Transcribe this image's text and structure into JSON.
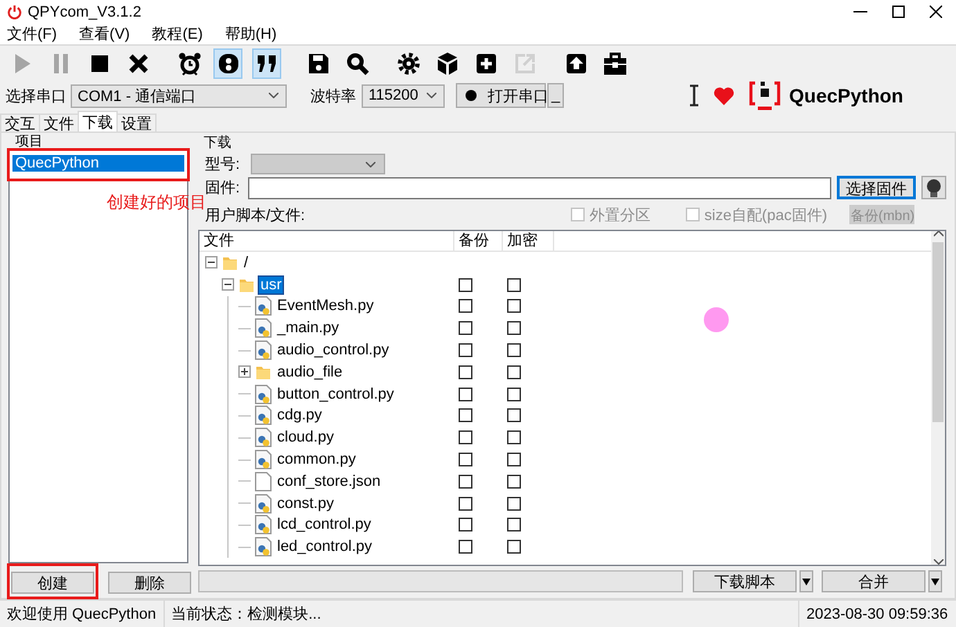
{
  "window": {
    "title": "QPYcom_V3.1.2"
  },
  "menu": [
    {
      "label": "文件(F)"
    },
    {
      "label": "查看(V)"
    },
    {
      "label": "教程(E)"
    },
    {
      "label": "帮助(H)"
    }
  ],
  "toolbar": [
    [
      {
        "kind": "play",
        "disabled": true,
        "pressed": false
      },
      {
        "kind": "pause",
        "disabled": true,
        "pressed": false
      },
      {
        "kind": "stop",
        "disabled": false,
        "pressed": false
      },
      {
        "kind": "cross",
        "disabled": false,
        "pressed": false
      }
    ],
    [
      {
        "kind": "alarm",
        "disabled": false,
        "pressed": false
      },
      {
        "kind": "badge",
        "disabled": false,
        "pressed": true
      },
      {
        "kind": "quote",
        "disabled": false,
        "pressed": true
      }
    ],
    [
      {
        "kind": "save",
        "disabled": false,
        "pressed": false
      },
      {
        "kind": "search",
        "disabled": false,
        "pressed": false
      }
    ],
    [
      {
        "kind": "gear",
        "disabled": false,
        "pressed": false
      },
      {
        "kind": "cube",
        "disabled": false,
        "pressed": false
      },
      {
        "kind": "add",
        "disabled": false,
        "pressed": false
      },
      {
        "kind": "export",
        "disabled": true,
        "pressed": false
      }
    ],
    [
      {
        "kind": "upload",
        "disabled": false,
        "pressed": false
      },
      {
        "kind": "toolbox",
        "disabled": false,
        "pressed": false
      }
    ]
  ],
  "port_bar": {
    "port_label": "选择串口",
    "port": "COM1 - 通信端口",
    "baud_label": "波特率",
    "baud": "115200",
    "open_button": "打开串口",
    "more_button": "_",
    "brand": "QuecPython"
  },
  "tabs": [
    {
      "label": "交互",
      "selected": false
    },
    {
      "label": "文件",
      "selected": false
    },
    {
      "label": "下载",
      "selected": true
    },
    {
      "label": "设置",
      "selected": false
    }
  ],
  "projects": {
    "title": "项目",
    "items": [
      {
        "name": "QuecPython",
        "selected": true,
        "highlighted": true
      }
    ],
    "buttons": [
      {
        "label": "创建",
        "highlighted": true
      },
      {
        "label": "删除",
        "highlighted": false
      }
    ]
  },
  "annotation": {
    "text": "创建好的项目"
  },
  "download": {
    "title": "下载",
    "model_label": "型号:",
    "model": {
      "disabled": true
    },
    "firmware_label": "固件:",
    "firmware_button": {
      "label": "选择固件",
      "focused": true
    },
    "scripts_label": "用户脚本/文件:",
    "options": [
      {
        "label": "外置分区",
        "checked": false,
        "disabled": true
      },
      {
        "label": "size自配(pac固件)",
        "checked": false,
        "disabled": true
      }
    ],
    "backup_button": {
      "label": "备份(mbn)",
      "disabled": true
    }
  },
  "tree": {
    "columns": [
      "文件",
      "备份",
      "加密"
    ],
    "items": [
      {
        "name": "/",
        "kind": "folder",
        "expanded": true,
        "selected": false,
        "children": [
          {
            "name": "usr",
            "kind": "folder",
            "expanded": true,
            "selected": true,
            "backup": false,
            "encrypt": false,
            "children": [
              {
                "name": "EventMesh.py",
                "kind": "python",
                "selected": false,
                "backup": false,
                "encrypt": false
              },
              {
                "name": "_main.py",
                "kind": "python",
                "selected": false,
                "backup": false,
                "encrypt": false
              },
              {
                "name": "audio_control.py",
                "kind": "python",
                "selected": false,
                "backup": false,
                "encrypt": false
              },
              {
                "name": "audio_file",
                "kind": "folder",
                "expanded": false,
                "selected": false,
                "backup": false,
                "encrypt": false
              },
              {
                "name": "button_control.py",
                "kind": "python",
                "selected": false,
                "backup": false,
                "encrypt": false
              },
              {
                "name": "cdg.py",
                "kind": "python",
                "selected": false,
                "backup": false,
                "encrypt": false
              },
              {
                "name": "cloud.py",
                "kind": "python",
                "selected": false,
                "backup": false,
                "encrypt": false
              },
              {
                "name": "common.py",
                "kind": "python",
                "selected": false,
                "backup": false,
                "encrypt": false
              },
              {
                "name": "conf_store.json",
                "kind": "file",
                "selected": false,
                "backup": false,
                "encrypt": false
              },
              {
                "name": "const.py",
                "kind": "python",
                "selected": false,
                "backup": false,
                "encrypt": false
              },
              {
                "name": "lcd_control.py",
                "kind": "python",
                "selected": false,
                "backup": false,
                "encrypt": false
              },
              {
                "name": "led_control.py",
                "kind": "python",
                "selected": false,
                "backup": false,
                "encrypt": false
              }
            ]
          }
        ]
      }
    ]
  },
  "progress": {
    "level": 0
  },
  "actions": [
    {
      "label": "下载脚本"
    },
    {
      "label": "合并"
    }
  ],
  "status_bar": {
    "welcome": "欢迎使用 QuecPython",
    "state": "当前状态：检测模块...",
    "time": "2023-08-30 09:59:36"
  }
}
